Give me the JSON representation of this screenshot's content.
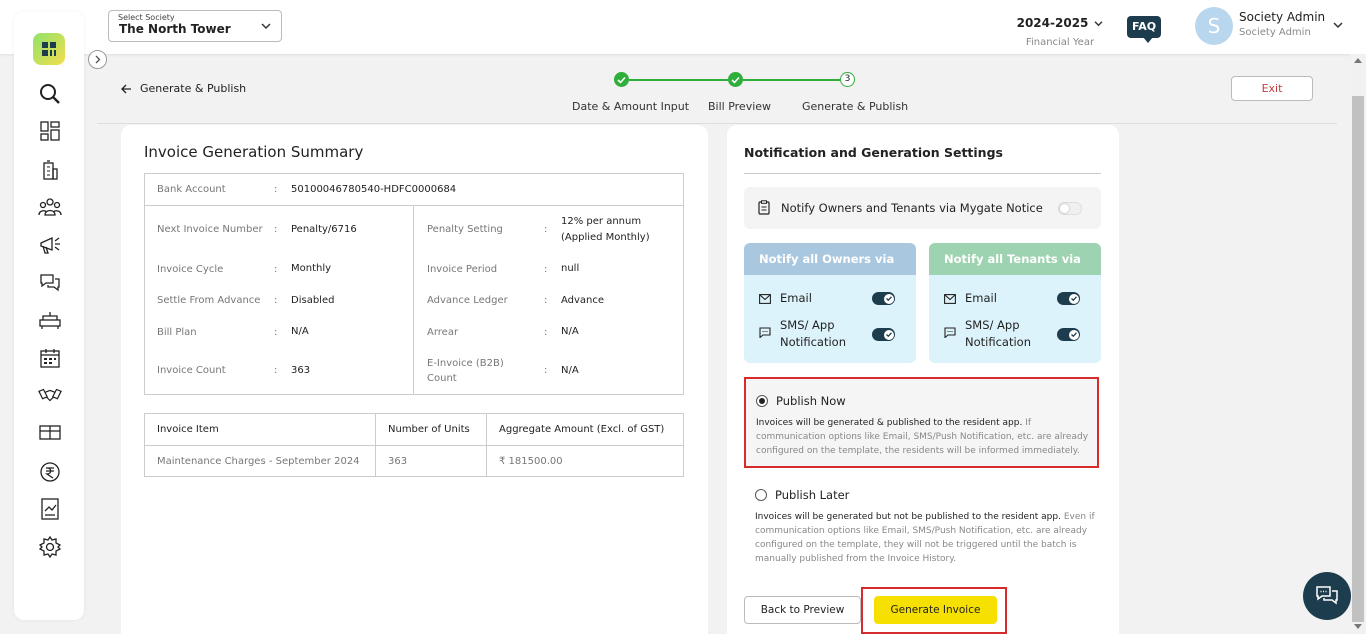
{
  "header": {
    "society_label": "Select Society",
    "society_value": "The North Tower",
    "financial_year": "2024-2025",
    "financial_year_label": "Financial Year",
    "faq": "FAQ",
    "avatar_initial": "S",
    "user_name": "Society Admin",
    "user_role": "Society Admin"
  },
  "sidebar": {
    "icons": [
      "search-icon",
      "dashboard-icon",
      "building-icon",
      "residents-icon",
      "announcement-icon",
      "helpdesk-icon",
      "amenities-icon",
      "calendar-icon",
      "handshake-icon",
      "inventory-icon",
      "rupee-icon",
      "reports-icon",
      "settings-icon"
    ]
  },
  "stepper": {
    "back_label": "Generate & Publish",
    "steps": [
      {
        "label": "Date & Amount Input",
        "status": "done"
      },
      {
        "label": "Bill Preview",
        "status": "done"
      },
      {
        "label": "Generate & Publish",
        "status": "current",
        "number": "3"
      }
    ],
    "exit_label": "Exit"
  },
  "summary": {
    "title": "Invoice Generation Summary",
    "bank_account_label": "Bank Account",
    "bank_account_value": "50100046780540-HDFC0000684",
    "left": [
      {
        "label": "Next Invoice Number",
        "value": "Penalty/6716"
      },
      {
        "label": "Invoice Cycle",
        "value": "Monthly"
      },
      {
        "label": "Settle From Advance",
        "value": "Disabled"
      },
      {
        "label": "Bill Plan",
        "value": "N/A"
      },
      {
        "label": "Invoice Count",
        "value": "363"
      }
    ],
    "right": [
      {
        "label": "Penalty Setting",
        "value_line1": "12% per annum",
        "value_line2": "(Applied Monthly)"
      },
      {
        "label": "Invoice Period",
        "value": "null"
      },
      {
        "label": "Advance Ledger",
        "value": "Advance"
      },
      {
        "label": "Arrear",
        "value": "N/A"
      },
      {
        "label_line1": "E-Invoice (B2B)",
        "label_line2": "Count",
        "value": "N/A"
      }
    ],
    "colon": ":"
  },
  "items_table": {
    "headers": [
      "Invoice Item",
      "Number of Units",
      "Aggregate Amount (Excl. of GST)"
    ],
    "rows": [
      [
        "Maintenance Charges - September 2024",
        "363",
        "₹ 181500.00"
      ]
    ]
  },
  "settings": {
    "title": "Notification and Generation Settings",
    "notify_notice_label": "Notify Owners and Tenants via Mygate Notice",
    "owners": {
      "title": "Notify all Owners via",
      "email": "Email",
      "sms_line1": "SMS/ App",
      "sms_line2": "Notification"
    },
    "tenants": {
      "title": "Notify all Tenants via",
      "email": "Email",
      "sms_line1": "SMS/ App",
      "sms_line2": "Notification"
    },
    "publish_now": {
      "title": "Publish Now",
      "desc_bold": "Invoices will be generated & published to the resident app.",
      "desc_rest": " If communication options like Email, SMS/Push Notification, etc. are already configured on the template, the residents will be informed immediately."
    },
    "publish_later": {
      "title": "Publish Later",
      "desc_bold": "Invoices will be generated but not be published to the resident app.",
      "desc_rest": " Even if communication options like Email, SMS/Push Notification, etc. are already configured on the template, they will not be triggered until the batch is manually published from the Invoice History."
    },
    "back_button": "Back to Preview",
    "generate_button": "Generate Invoice"
  },
  "colors": {
    "accent_green": "#2eae3a",
    "dark_navy": "#1d3c4d",
    "generate_yellow": "#f5e000",
    "highlight_red": "#d82c2c"
  }
}
